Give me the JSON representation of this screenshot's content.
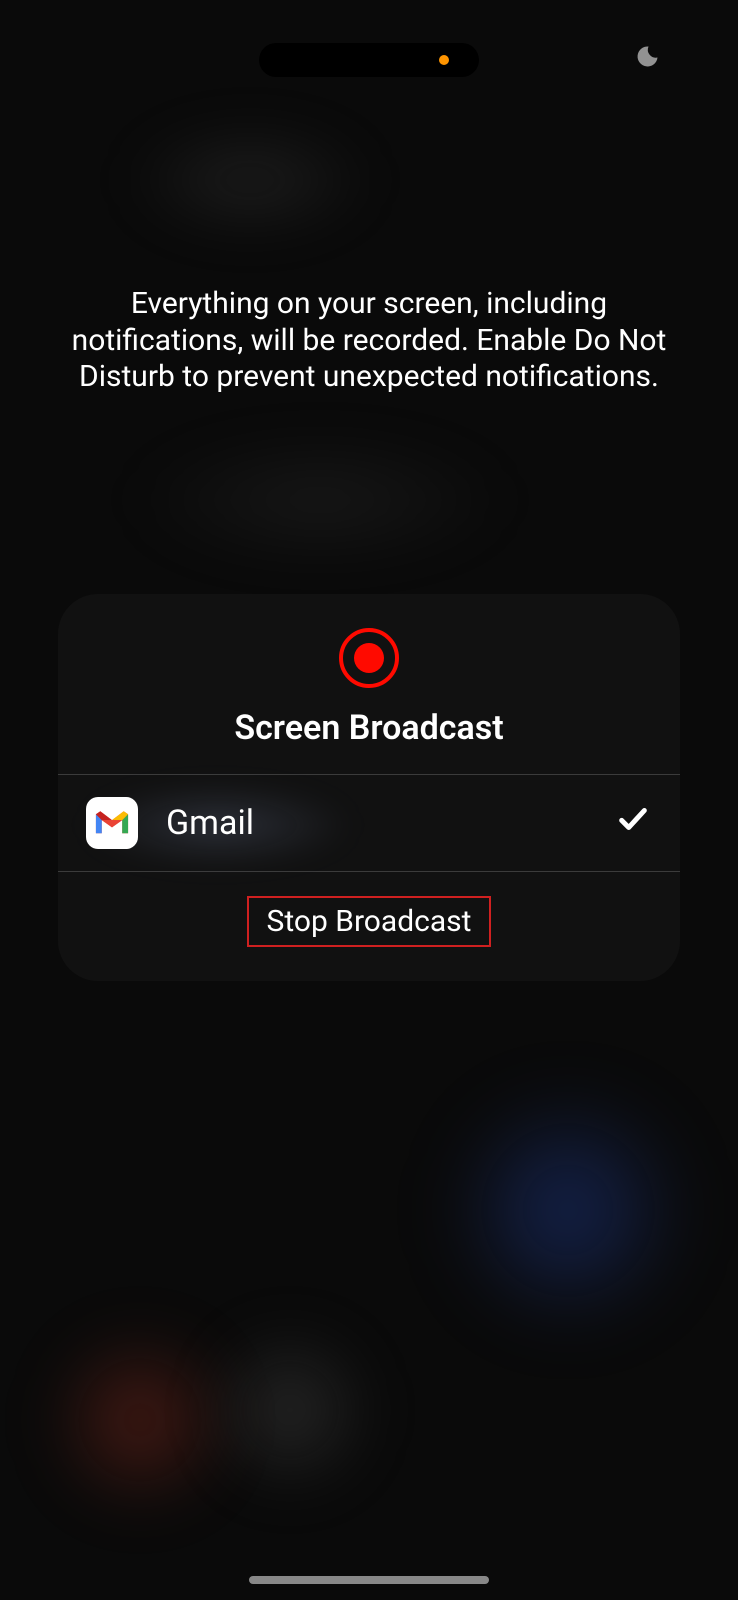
{
  "description_text": "Everything on your screen, including notifications, will be recorded. Enable Do Not Disturb to prevent unexpected notifications.",
  "card": {
    "title": "Screen Broadcast",
    "selected_app": "Gmail",
    "stop_label": "Stop Broadcast"
  }
}
